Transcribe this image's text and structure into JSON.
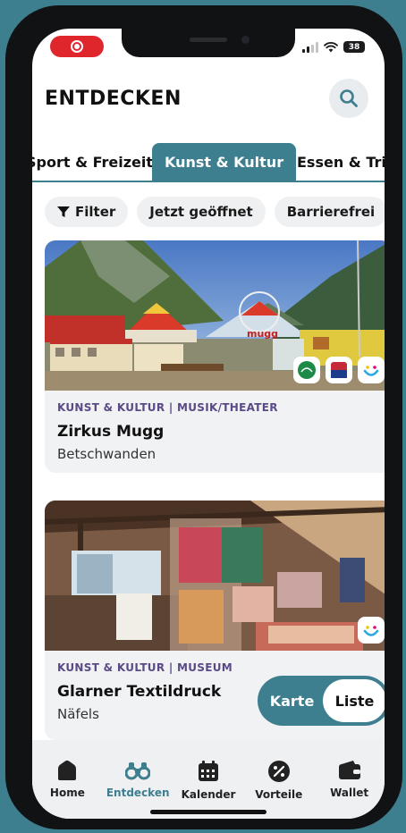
{
  "status": {
    "battery": "38"
  },
  "header": {
    "title": "ENTDECKEN"
  },
  "tabs": [
    {
      "label": "Sport & Freizeit"
    },
    {
      "label": "Kunst & Kultur"
    },
    {
      "label": "Essen & Trinken"
    }
  ],
  "filters": [
    {
      "label": "Filter"
    },
    {
      "label": "Jetzt geöffnet"
    },
    {
      "label": "Barrierefrei"
    }
  ],
  "cards": [
    {
      "category": "KUNST & KULTUR | MUSIK/THEATER",
      "name": "Zirkus Mugg",
      "place": "Betschwanden",
      "sign_text": "mugg"
    },
    {
      "category": "KUNST & KULTUR | MUSEUM",
      "name": "Glarner Textildruck",
      "place": "Näfels"
    }
  ],
  "view_toggle": {
    "map_label": "Karte",
    "list_label": "Liste"
  },
  "nav": [
    {
      "label": "Home",
      "icon": "home-icon"
    },
    {
      "label": "Entdecken",
      "icon": "binoculars-icon"
    },
    {
      "label": "Kalender",
      "icon": "calendar-icon"
    },
    {
      "label": "Vorteile",
      "icon": "percent-icon"
    },
    {
      "label": "Wallet",
      "icon": "wallet-icon"
    }
  ],
  "colors": {
    "accent": "#3d7e8f",
    "category": "#5a4a86",
    "record": "#e0262d"
  }
}
